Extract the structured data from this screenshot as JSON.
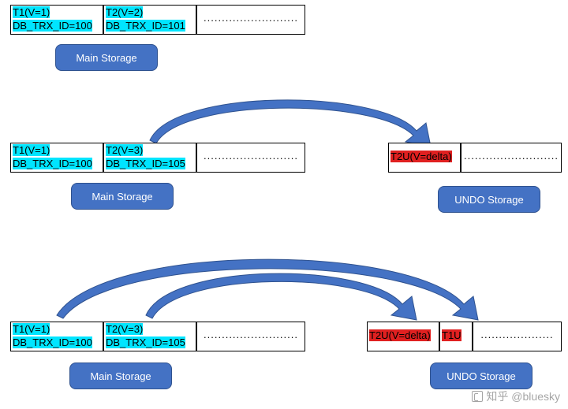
{
  "section1": {
    "main": {
      "cells": [
        {
          "l1": "T1(V=1)",
          "l2": "DB_TRX_ID=100"
        },
        {
          "l1": "T2(V=2)",
          "l2": "DB_TRX_ID=101"
        }
      ],
      "dots": "..........................",
      "label": "Main Storage"
    }
  },
  "section2": {
    "main": {
      "cells": [
        {
          "l1": "T1(V=1)",
          "l2": "DB_TRX_ID=100"
        },
        {
          "l1": "T2(V=3)",
          "l2": "DB_TRX_ID=105"
        }
      ],
      "dots": "..........................",
      "label": "Main Storage"
    },
    "undo": {
      "cell1": "T2U(V=delta)",
      "dots": "..........................",
      "label": "UNDO Storage"
    }
  },
  "section3": {
    "main": {
      "cells": [
        {
          "l1": "T1(V=1)",
          "l2": "DB_TRX_ID=100"
        },
        {
          "l1": "T2(V=3)",
          "l2": "DB_TRX_ID=105"
        }
      ],
      "dots": "..........................",
      "label": "Main Storage"
    },
    "undo": {
      "cell1": "T2U(V=delta)",
      "cell2": "T1U",
      "dots": "....................",
      "label": "UNDO Storage"
    }
  },
  "watermark": "知乎 @bluesky"
}
